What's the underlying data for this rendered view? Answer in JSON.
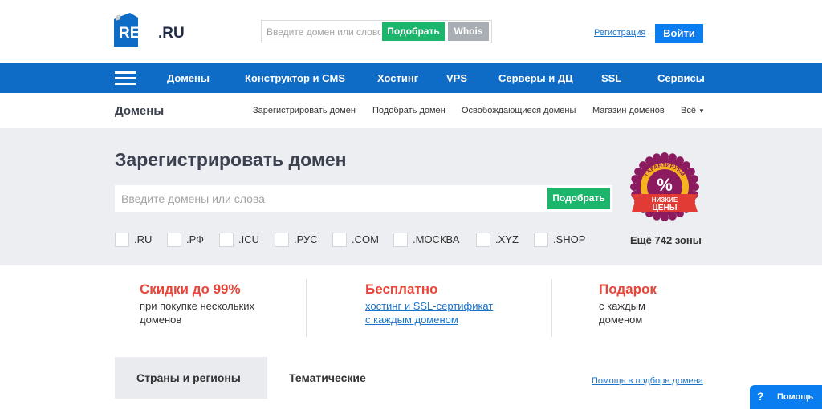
{
  "header": {
    "logo_text": "REG",
    "logo_suffix": ".RU",
    "search_placeholder": "Введите домен или слово",
    "pick_button": "Подобрать",
    "whois_button": "Whois",
    "register_link": "Регистрация",
    "login_button": "Войти"
  },
  "mainnav": {
    "items": [
      "Домены",
      "Конструктор и CMS",
      "Хостинг",
      "VPS",
      "Серверы и ДЦ",
      "SSL",
      "Сервисы"
    ]
  },
  "subnav": {
    "title": "Домены",
    "items": [
      "Зарегистрировать домен",
      "Подобрать домен",
      "Освобождающиеся домены",
      "Магазин доменов",
      "Всё"
    ]
  },
  "hero": {
    "title": "Зарегистрировать домен",
    "search_placeholder": "Введите домены или слова",
    "pick_button": "Подобрать",
    "zones": [
      ".RU",
      ".РФ",
      ".ICU",
      ".РУС",
      ".COM",
      ".МОСКВА",
      ".XYZ",
      ".SHOP"
    ],
    "more_zones": "Ещё 742 зоны",
    "badge": {
      "top_text": "ГАРАНТИРУЕМ",
      "symbol": "%",
      "ribbon_line1": "НИЗКИЕ",
      "ribbon_line2": "ЦЕНЫ",
      "colors": {
        "ring": "#8b1a5e",
        "gold": "#f7b31e",
        "ribbon": "#e23b36"
      }
    }
  },
  "promos": [
    {
      "heading": "Скидки до 99%",
      "line1": "при покупке нескольких",
      "line2": "доменов"
    },
    {
      "heading": "Бесплатно",
      "link1": "хостинг и SSL-сертификат",
      "link2": "с каждым доменом"
    },
    {
      "heading": "Подарок",
      "line1": "с каждым",
      "line2": "доменом"
    }
  ],
  "tabs": {
    "items": [
      "Страны и регионы",
      "Тематические"
    ],
    "help_link": "Помощь в подборе домена"
  },
  "help_widget": {
    "icon": "?",
    "label": "Помощь"
  },
  "colors": {
    "brand_blue": "#0e6cc7",
    "button_green": "#1cb56c",
    "accent_red": "#e8463a",
    "link_blue": "#1a73c9"
  }
}
